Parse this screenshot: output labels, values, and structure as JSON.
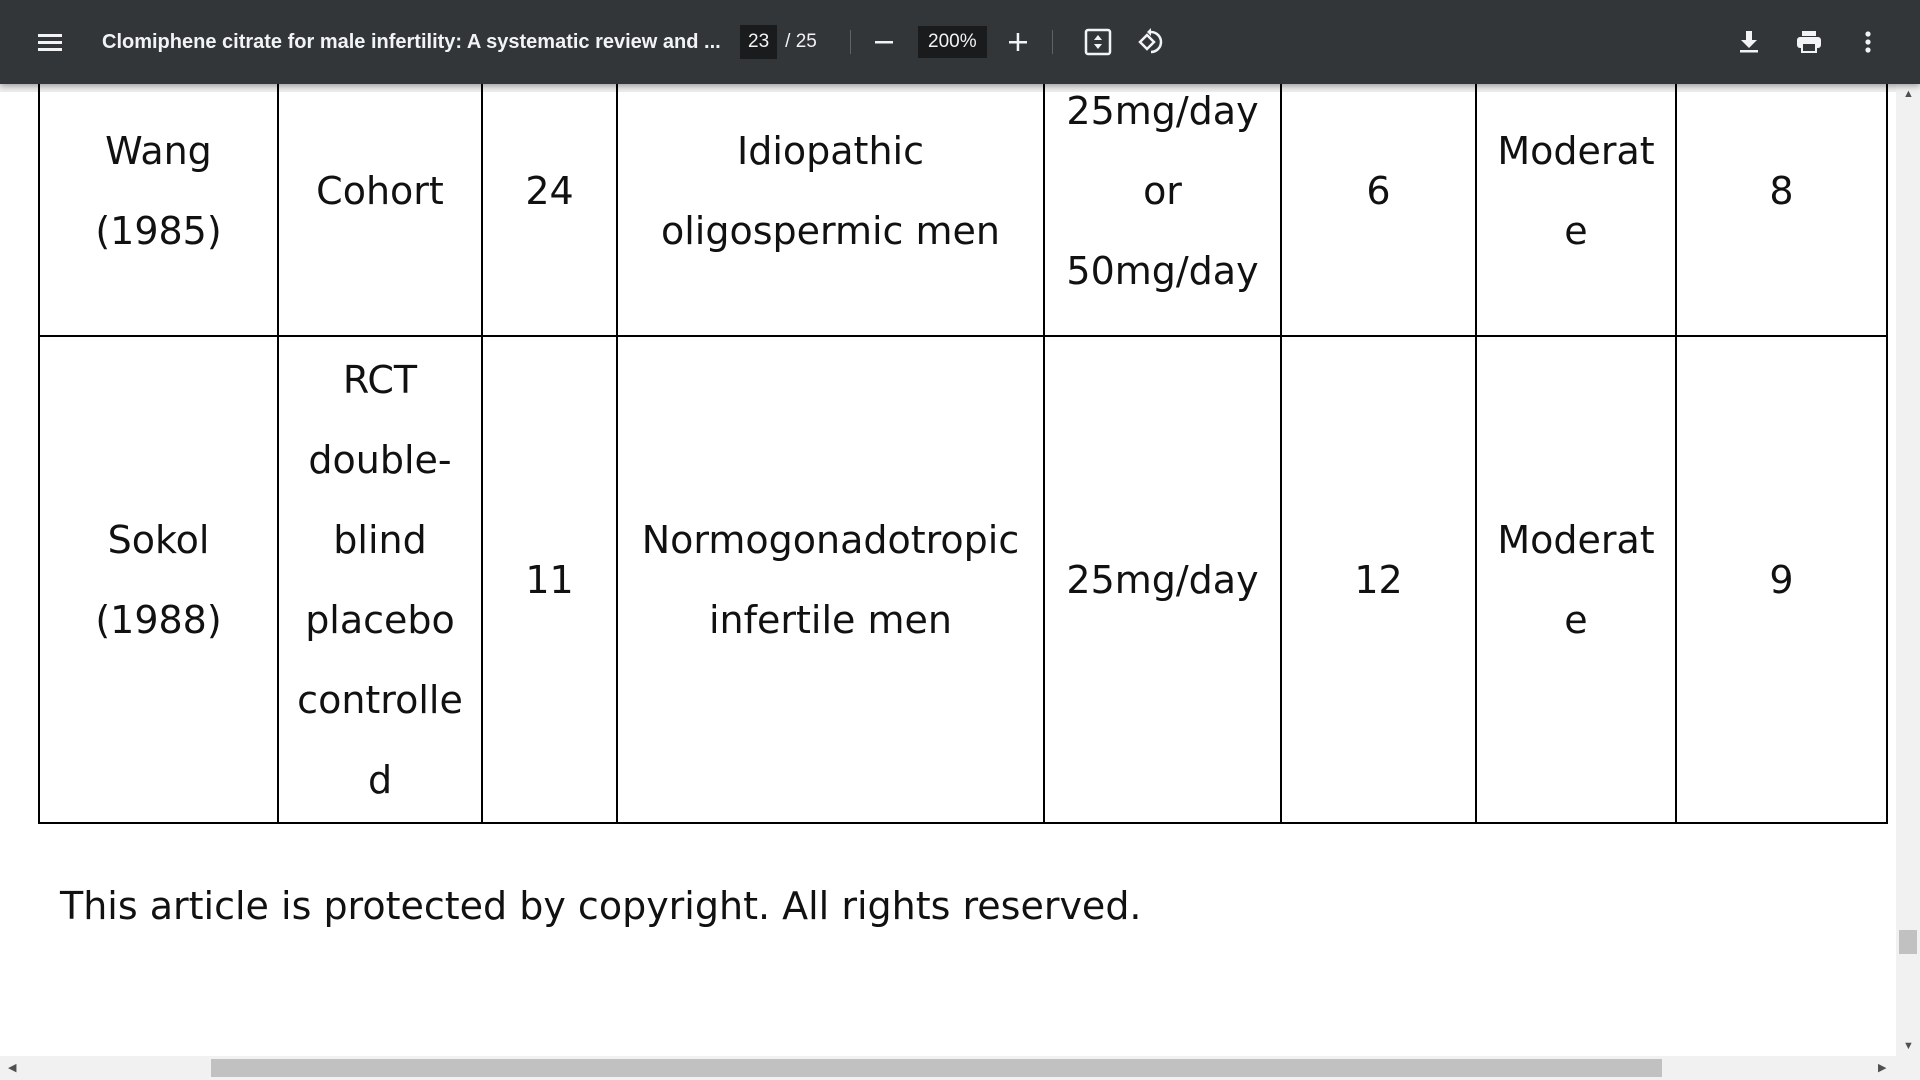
{
  "toolbar": {
    "title": "Clomiphene citrate for male infertility: A systematic review and ...",
    "current_page": "23",
    "total_pages": "/ 25",
    "zoom": "200%",
    "icons": [
      "menu-icon",
      "zoom-out-icon",
      "zoom-in-icon",
      "fit-page-icon",
      "rotate-icon",
      "download-icon",
      "print-icon",
      "more-vert-icon"
    ]
  },
  "table": {
    "rows": [
      {
        "cells": [
          [
            "Wang",
            "(1985)"
          ],
          [
            "Cohort"
          ],
          [
            "24"
          ],
          [
            "Idiopathic",
            "oligospermic men"
          ],
          [
            "25mg/day",
            "or",
            "50mg/day"
          ],
          [
            "6"
          ],
          [
            "Moderat",
            "e"
          ],
          [
            "8"
          ]
        ]
      },
      {
        "cells": [
          [
            "Sokol",
            "(1988)"
          ],
          [
            "RCT",
            "double-",
            "blind",
            "placebo",
            "controlle",
            "d"
          ],
          [
            "11"
          ],
          [
            "Normogonadotropic",
            "infertile men"
          ],
          [
            "25mg/day"
          ],
          [
            "12"
          ],
          [
            "Moderat",
            "e"
          ],
          [
            "9"
          ]
        ]
      }
    ]
  },
  "footer": {
    "copyright": "This article is protected by copyright. All rights reserved."
  }
}
